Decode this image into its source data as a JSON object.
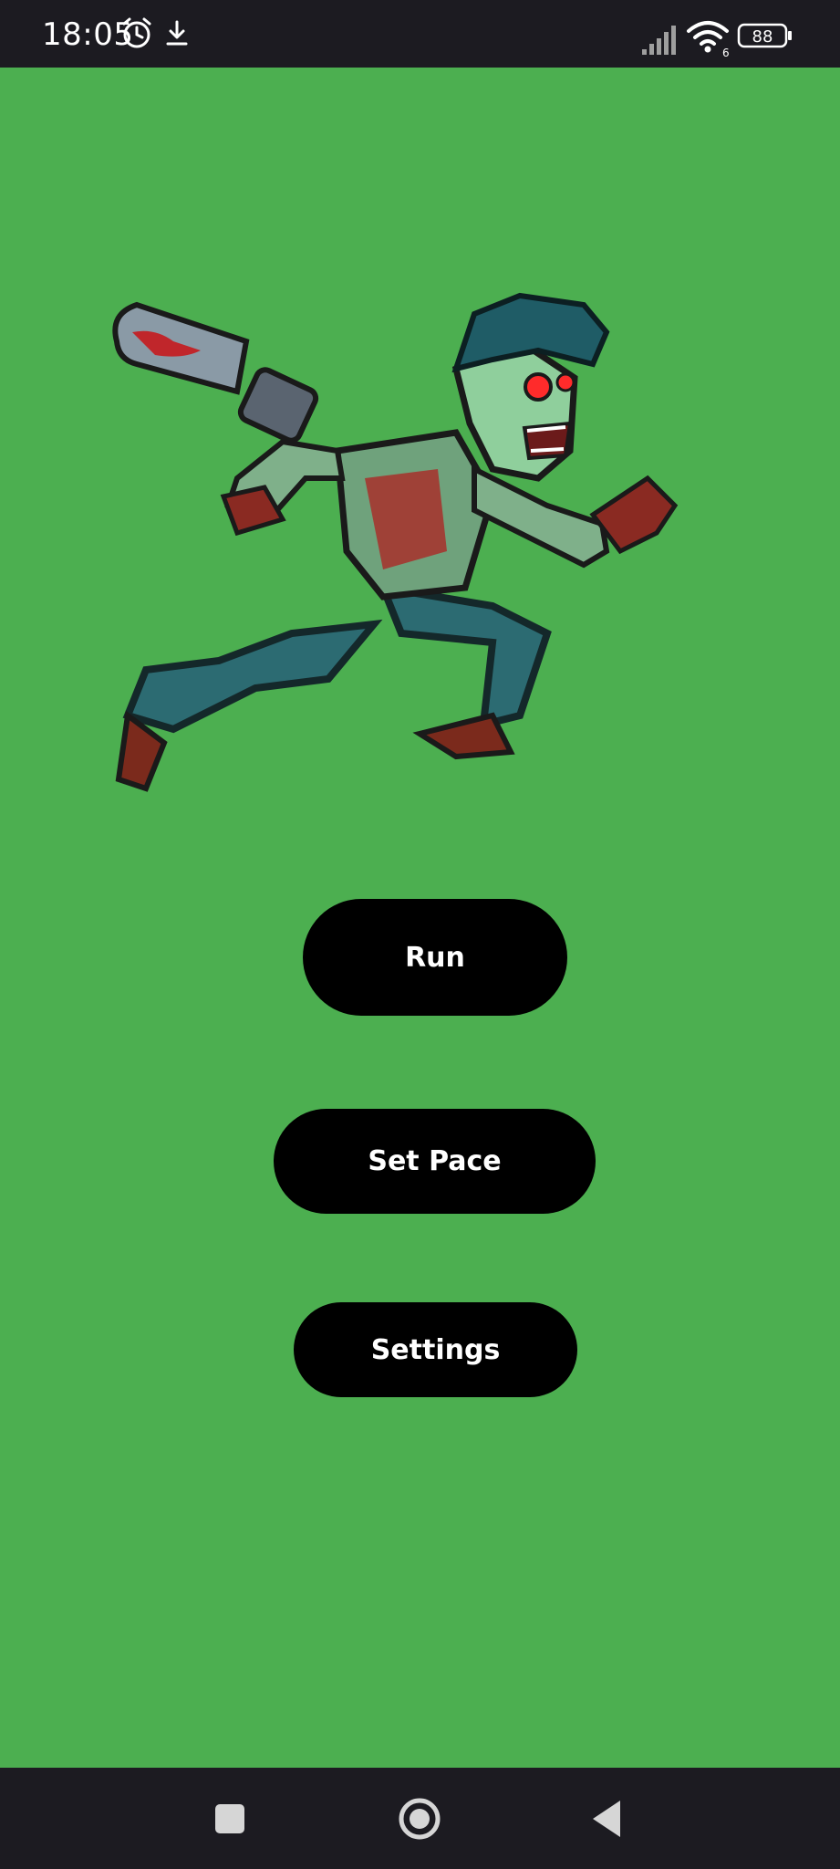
{
  "status_bar": {
    "time": "18:05",
    "icons": [
      "alarm-icon",
      "download-icon",
      "signal-icon",
      "wifi-icon",
      "battery-icon"
    ],
    "wifi_badge": "6",
    "battery_level": "88"
  },
  "main": {
    "illustration": "running-zombie-with-chainsaw",
    "buttons": {
      "run": "Run",
      "set_pace": "Set Pace",
      "settings": "Settings"
    }
  },
  "navigation_bar": {
    "icons": [
      "recents-icon",
      "home-icon",
      "back-icon"
    ]
  },
  "colors": {
    "background": "#4caf50",
    "button": "#000000",
    "button_text": "#ffffff",
    "system_bars": "#1c1b21"
  }
}
